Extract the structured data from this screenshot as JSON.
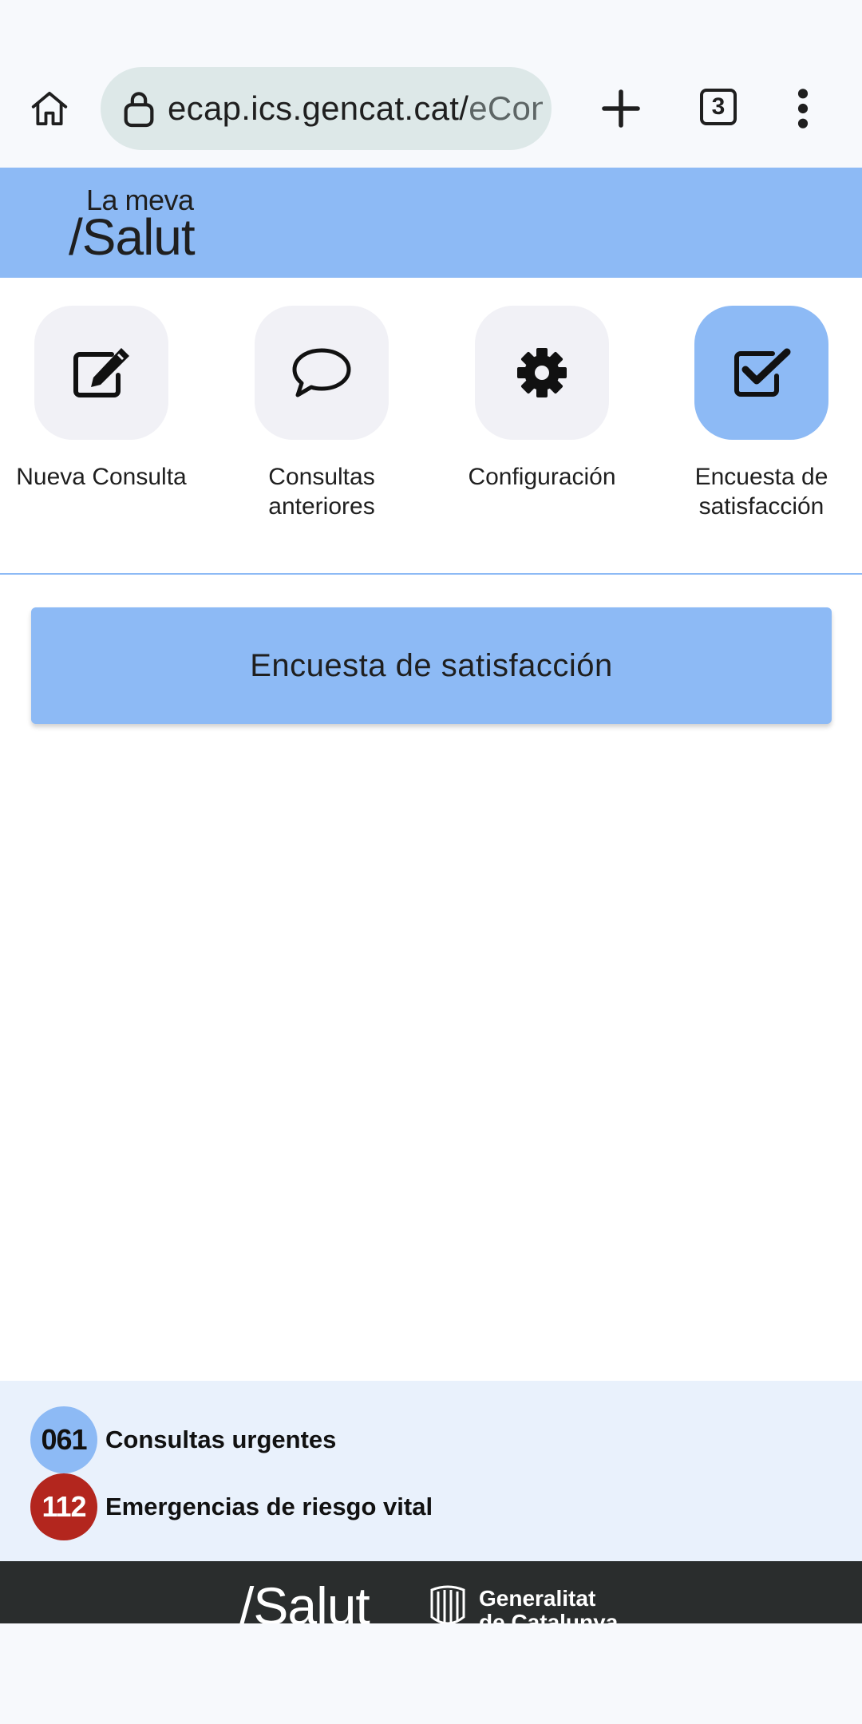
{
  "browser": {
    "url_main": "ecap.ics.gencat.cat/",
    "url_tail": "eCon",
    "tab_count": "3",
    "icons": [
      "home-icon",
      "lock-icon",
      "plus-icon",
      "tabs-icon",
      "more-vert-icon"
    ]
  },
  "header": {
    "brand_small": "La meva",
    "brand_big": "/Salut"
  },
  "nav": {
    "items": [
      {
        "label": "Nueva Consulta",
        "icon": "edit-icon",
        "active": false
      },
      {
        "label": "Consultas anteriores",
        "icon": "chat-bubble-icon",
        "active": false
      },
      {
        "label": "Configuración",
        "icon": "gear-icon",
        "active": false
      },
      {
        "label": "Encuesta de satisfacción",
        "icon": "checkbox-icon",
        "active": true
      }
    ]
  },
  "main": {
    "banner_title": "Encuesta de satisfacción"
  },
  "emergency": {
    "items": [
      {
        "number": "061",
        "text": "Consultas urgentes",
        "color": "#8dbaf5"
      },
      {
        "number": "112",
        "text": "Emergencias de riesgo vital",
        "color": "#b3261e"
      }
    ]
  },
  "footer": {
    "brand": "/Salut",
    "gov_line1": "Generalitat",
    "gov_line2": "de Catalunya"
  },
  "colors": {
    "accent": "#8dbaf5",
    "tile": "#f1f1f6",
    "footer_dark": "#2a2d2d",
    "emergency_bg": "#e9f1fc"
  }
}
